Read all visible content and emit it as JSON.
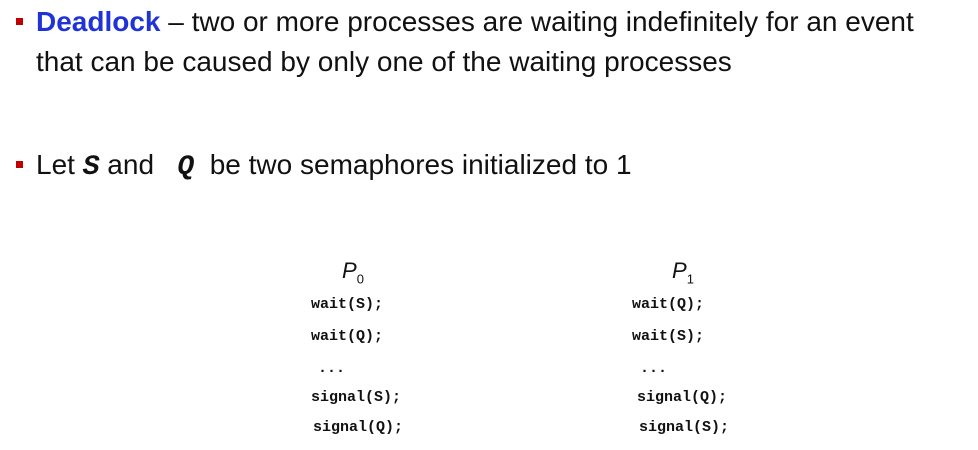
{
  "bullets": {
    "deadlock": {
      "term": "Deadlock",
      "definition": " – two or more processes are waiting indefinitely for an event that can be caused by only one of the waiting processes"
    },
    "semaphores": {
      "prefix": "Let ",
      "s": "S",
      "and": " and ",
      "q": "Q",
      "suffix": " be two semaphores initialized to 1"
    }
  },
  "processes": {
    "p0": {
      "name": "P",
      "subscript": "0",
      "lines": [
        "wait(S);",
        "wait(Q);",
        "...",
        "signal(S);",
        "signal(Q);"
      ]
    },
    "p1": {
      "name": "P",
      "subscript": "1",
      "lines": [
        "wait(Q);",
        "wait(S);",
        "...",
        "signal(Q);",
        "signal(S);"
      ]
    }
  },
  "colors": {
    "bullet_marker": "#c00000",
    "term": "#1f33d6"
  }
}
